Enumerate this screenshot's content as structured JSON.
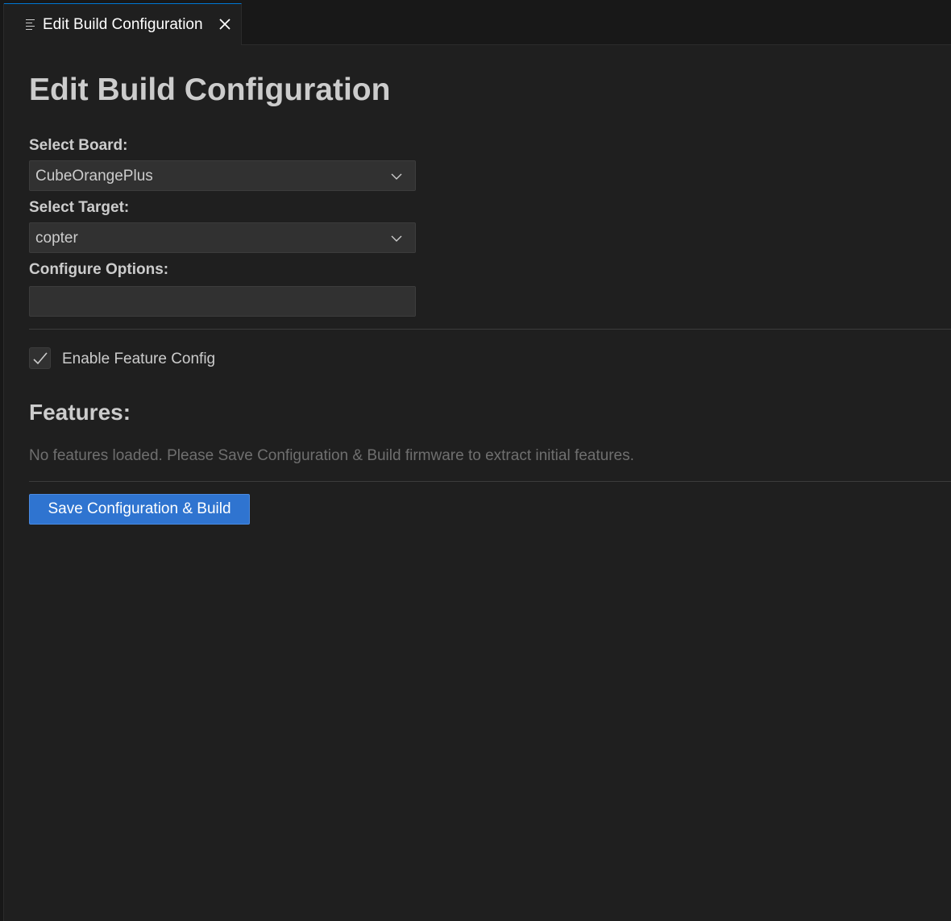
{
  "tab": {
    "icon": "preview-lines-icon",
    "label": "Edit Build Configuration",
    "close_icon": "close-icon"
  },
  "page": {
    "title": "Edit Build Configuration"
  },
  "form": {
    "board_label": "Select Board:",
    "board_value": "CubeOrangePlus",
    "target_label": "Select Target:",
    "target_value": "copter",
    "options_label": "Configure Options:",
    "options_value": "",
    "feature_config_label": "Enable Feature Config",
    "feature_config_checked": true
  },
  "features": {
    "title": "Features:",
    "empty_message": "No features loaded. Please Save Configuration & Build firmware to extract initial features."
  },
  "actions": {
    "save_build_label": "Save Configuration & Build"
  },
  "colors": {
    "background": "#1f1f1f",
    "tab_active_border": "#0078d4",
    "button_primary": "#2f74d0",
    "input_background": "#313131"
  }
}
